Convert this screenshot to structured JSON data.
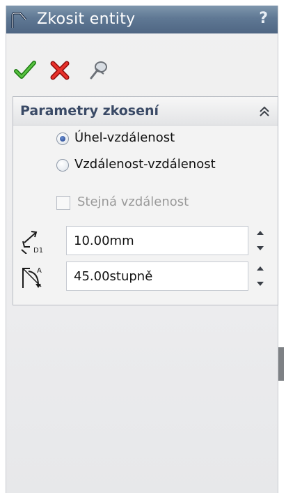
{
  "window": {
    "title": "Zkosit entity",
    "help_label": "?"
  },
  "toolbar": {
    "ok_icon": "checkmark-icon",
    "cancel_icon": "close-icon",
    "pin_icon": "pushpin-icon"
  },
  "group": {
    "title": "Parametry zkosení",
    "collapse_icon": "chevron-double-up-icon"
  },
  "options": {
    "radio_angle_distance": "Úhel-vzdálenost",
    "radio_distance_distance": "Vzdálenost-vzdálenost",
    "selected": "Úhel-vzdálenost",
    "equal_distance": "Stejná vzdálenost"
  },
  "fields": {
    "distance_value": "10.00mm",
    "angle_value": "45.00stupně",
    "distance_icon_label": "D1",
    "angle_icon_label": "A"
  },
  "colors": {
    "titlebar": "#5f7894",
    "ok": "#3aa32a",
    "cancel": "#d32020",
    "group_title": "#3a4a66"
  }
}
